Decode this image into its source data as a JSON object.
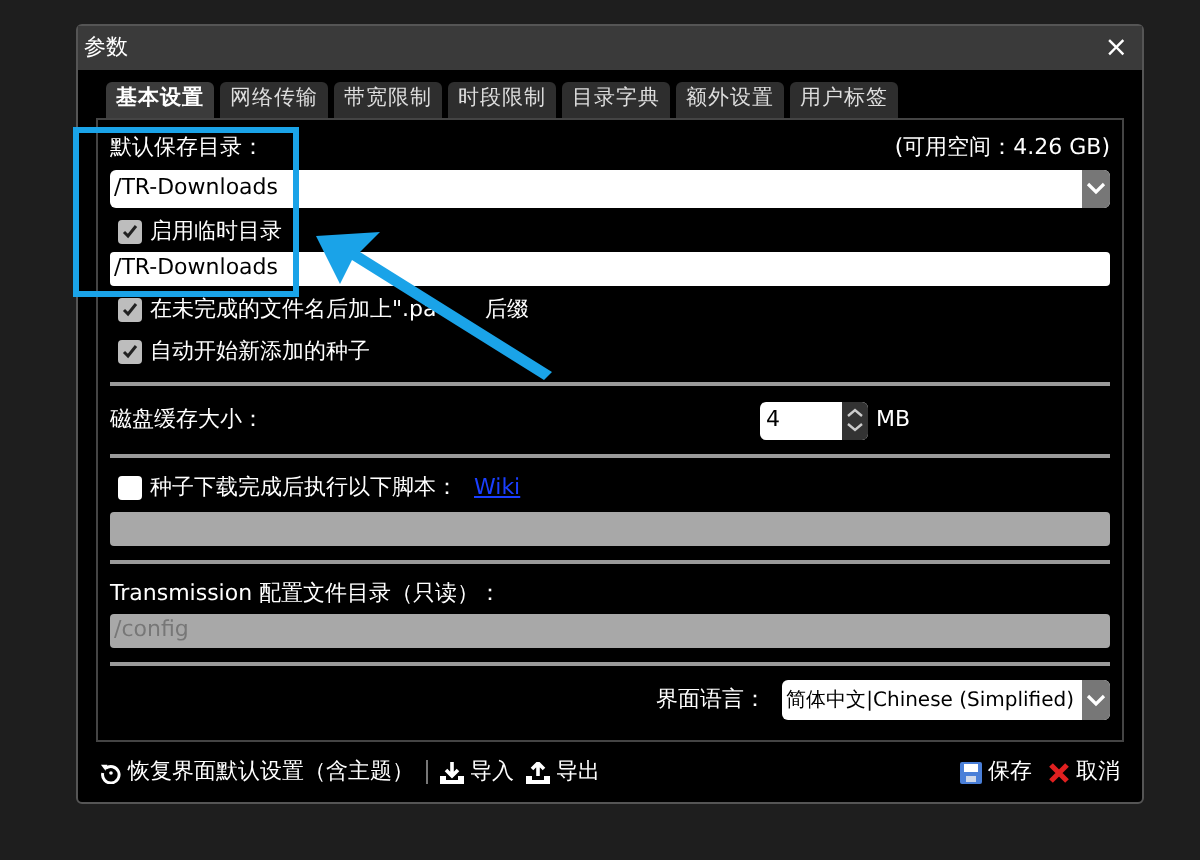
{
  "dialog": {
    "title": "参数",
    "close": "×"
  },
  "tabs": [
    {
      "label": "基本设置",
      "selected": true
    },
    {
      "label": "网络传输",
      "selected": false
    },
    {
      "label": "带宽限制",
      "selected": false
    },
    {
      "label": "时段限制",
      "selected": false
    },
    {
      "label": "目录字典",
      "selected": false
    },
    {
      "label": "额外设置",
      "selected": false
    },
    {
      "label": "用户标签",
      "selected": false
    }
  ],
  "download_dir": {
    "label": "默认保存目录：",
    "free_space": "(可用空间：4.26 GB)",
    "value": "/TR-Downloads"
  },
  "temp_dir": {
    "label": "启用临时目录",
    "checked": true,
    "value": "/TR-Downloads"
  },
  "options": [
    {
      "label": "在未完成的文件名后加上\".pa",
      "label_end": "后缀",
      "checked": true
    },
    {
      "label": "自动开始新添加的种子",
      "checked": true
    }
  ],
  "cache": {
    "label": "磁盘缓存大小：",
    "value": "4",
    "unit": "MB"
  },
  "script": {
    "label": "种子下载完成后执行以下脚本：",
    "link": "Wiki",
    "checked": false
  },
  "config_dir": {
    "label": "Transmission 配置文件目录（只读）：",
    "value": "/config"
  },
  "language": {
    "label": "界面语言：",
    "value": "简体中文|Chinese (Simplified)"
  },
  "footer": {
    "reset": "恢复界面默认设置（含主题）",
    "import": "导入",
    "export": "导出",
    "save": "保存",
    "cancel": "取消"
  }
}
